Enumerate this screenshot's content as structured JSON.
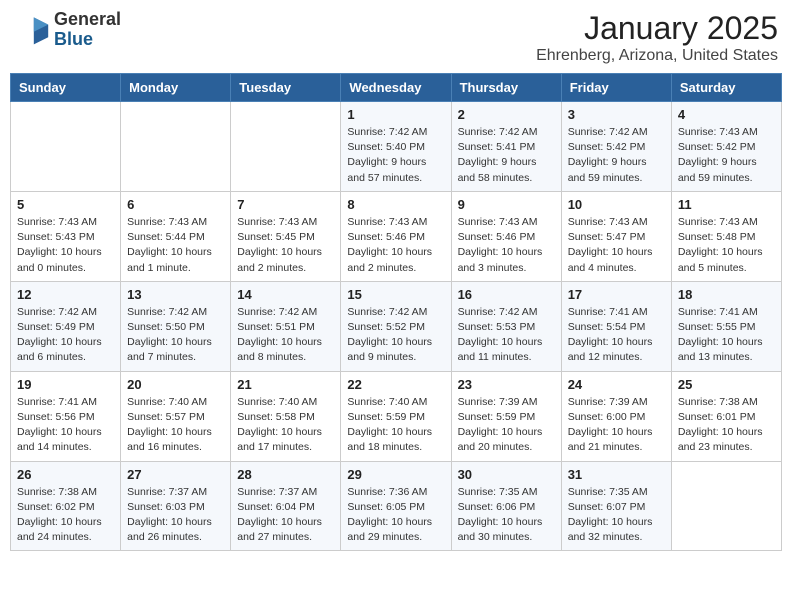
{
  "logo": {
    "general": "General",
    "blue": "Blue"
  },
  "header": {
    "title": "January 2025",
    "subtitle": "Ehrenberg, Arizona, United States"
  },
  "weekdays": [
    "Sunday",
    "Monday",
    "Tuesday",
    "Wednesday",
    "Thursday",
    "Friday",
    "Saturday"
  ],
  "weeks": [
    [
      {
        "day": "",
        "info": ""
      },
      {
        "day": "",
        "info": ""
      },
      {
        "day": "",
        "info": ""
      },
      {
        "day": "1",
        "info": "Sunrise: 7:42 AM\nSunset: 5:40 PM\nDaylight: 9 hours and 57 minutes."
      },
      {
        "day": "2",
        "info": "Sunrise: 7:42 AM\nSunset: 5:41 PM\nDaylight: 9 hours and 58 minutes."
      },
      {
        "day": "3",
        "info": "Sunrise: 7:42 AM\nSunset: 5:42 PM\nDaylight: 9 hours and 59 minutes."
      },
      {
        "day": "4",
        "info": "Sunrise: 7:43 AM\nSunset: 5:42 PM\nDaylight: 9 hours and 59 minutes."
      }
    ],
    [
      {
        "day": "5",
        "info": "Sunrise: 7:43 AM\nSunset: 5:43 PM\nDaylight: 10 hours and 0 minutes."
      },
      {
        "day": "6",
        "info": "Sunrise: 7:43 AM\nSunset: 5:44 PM\nDaylight: 10 hours and 1 minute."
      },
      {
        "day": "7",
        "info": "Sunrise: 7:43 AM\nSunset: 5:45 PM\nDaylight: 10 hours and 2 minutes."
      },
      {
        "day": "8",
        "info": "Sunrise: 7:43 AM\nSunset: 5:46 PM\nDaylight: 10 hours and 2 minutes."
      },
      {
        "day": "9",
        "info": "Sunrise: 7:43 AM\nSunset: 5:46 PM\nDaylight: 10 hours and 3 minutes."
      },
      {
        "day": "10",
        "info": "Sunrise: 7:43 AM\nSunset: 5:47 PM\nDaylight: 10 hours and 4 minutes."
      },
      {
        "day": "11",
        "info": "Sunrise: 7:43 AM\nSunset: 5:48 PM\nDaylight: 10 hours and 5 minutes."
      }
    ],
    [
      {
        "day": "12",
        "info": "Sunrise: 7:42 AM\nSunset: 5:49 PM\nDaylight: 10 hours and 6 minutes."
      },
      {
        "day": "13",
        "info": "Sunrise: 7:42 AM\nSunset: 5:50 PM\nDaylight: 10 hours and 7 minutes."
      },
      {
        "day": "14",
        "info": "Sunrise: 7:42 AM\nSunset: 5:51 PM\nDaylight: 10 hours and 8 minutes."
      },
      {
        "day": "15",
        "info": "Sunrise: 7:42 AM\nSunset: 5:52 PM\nDaylight: 10 hours and 9 minutes."
      },
      {
        "day": "16",
        "info": "Sunrise: 7:42 AM\nSunset: 5:53 PM\nDaylight: 10 hours and 11 minutes."
      },
      {
        "day": "17",
        "info": "Sunrise: 7:41 AM\nSunset: 5:54 PM\nDaylight: 10 hours and 12 minutes."
      },
      {
        "day": "18",
        "info": "Sunrise: 7:41 AM\nSunset: 5:55 PM\nDaylight: 10 hours and 13 minutes."
      }
    ],
    [
      {
        "day": "19",
        "info": "Sunrise: 7:41 AM\nSunset: 5:56 PM\nDaylight: 10 hours and 14 minutes."
      },
      {
        "day": "20",
        "info": "Sunrise: 7:40 AM\nSunset: 5:57 PM\nDaylight: 10 hours and 16 minutes."
      },
      {
        "day": "21",
        "info": "Sunrise: 7:40 AM\nSunset: 5:58 PM\nDaylight: 10 hours and 17 minutes."
      },
      {
        "day": "22",
        "info": "Sunrise: 7:40 AM\nSunset: 5:59 PM\nDaylight: 10 hours and 18 minutes."
      },
      {
        "day": "23",
        "info": "Sunrise: 7:39 AM\nSunset: 5:59 PM\nDaylight: 10 hours and 20 minutes."
      },
      {
        "day": "24",
        "info": "Sunrise: 7:39 AM\nSunset: 6:00 PM\nDaylight: 10 hours and 21 minutes."
      },
      {
        "day": "25",
        "info": "Sunrise: 7:38 AM\nSunset: 6:01 PM\nDaylight: 10 hours and 23 minutes."
      }
    ],
    [
      {
        "day": "26",
        "info": "Sunrise: 7:38 AM\nSunset: 6:02 PM\nDaylight: 10 hours and 24 minutes."
      },
      {
        "day": "27",
        "info": "Sunrise: 7:37 AM\nSunset: 6:03 PM\nDaylight: 10 hours and 26 minutes."
      },
      {
        "day": "28",
        "info": "Sunrise: 7:37 AM\nSunset: 6:04 PM\nDaylight: 10 hours and 27 minutes."
      },
      {
        "day": "29",
        "info": "Sunrise: 7:36 AM\nSunset: 6:05 PM\nDaylight: 10 hours and 29 minutes."
      },
      {
        "day": "30",
        "info": "Sunrise: 7:35 AM\nSunset: 6:06 PM\nDaylight: 10 hours and 30 minutes."
      },
      {
        "day": "31",
        "info": "Sunrise: 7:35 AM\nSunset: 6:07 PM\nDaylight: 10 hours and 32 minutes."
      },
      {
        "day": "",
        "info": ""
      }
    ]
  ]
}
